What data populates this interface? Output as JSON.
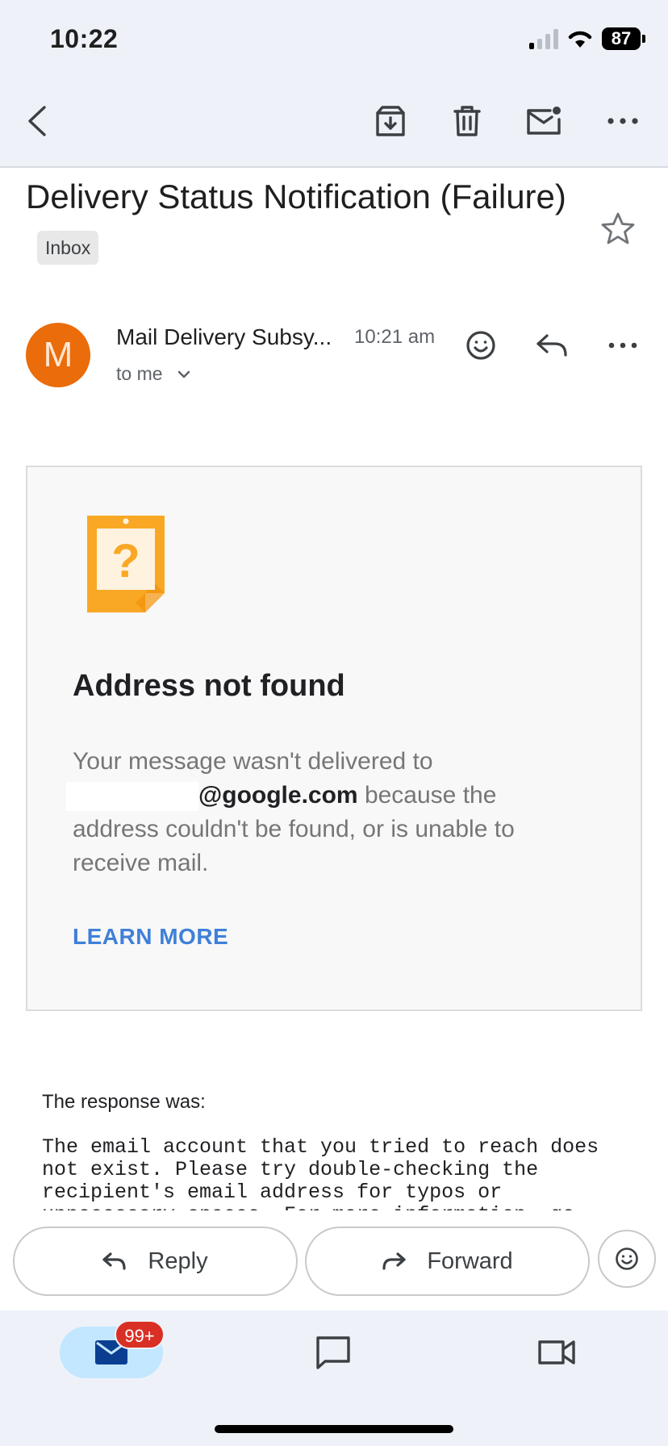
{
  "status_bar": {
    "time": "10:22",
    "battery": "87"
  },
  "toolbar": {
    "back_icon": "chevron-left-icon",
    "archive_icon": "archive-icon",
    "delete_icon": "trash-icon",
    "mark_unread_icon": "mark-unread-icon",
    "more_icon": "more-horizontal-icon"
  },
  "email": {
    "subject": "Delivery Status Notification (Failure)",
    "label": "Inbox",
    "sender_initial": "M",
    "sender_name": "Mail Delivery Subsy...",
    "time": "10:21 am",
    "recipient": "to me",
    "avatar_color": "#ea6c0b"
  },
  "card": {
    "title": "Address not found",
    "body_prefix": "Your message wasn't delivered to",
    "address_domain": "@google.com",
    "body_suffix": "because the address couldn't be found, or is unable to receive mail.",
    "link": "LEARN MORE",
    "link_color": "#3f80d8"
  },
  "response": {
    "label": "The response was:",
    "text": "The email account that you tried to reach does\nnot exist. Please try double-checking the\nrecipient's email address for typos or\nunnecessary spaces. For more information, go"
  },
  "actions": {
    "reply": "Reply",
    "forward": "Forward"
  },
  "bottom_nav": {
    "mail_badge": "99+",
    "badge_color": "#d93025"
  }
}
